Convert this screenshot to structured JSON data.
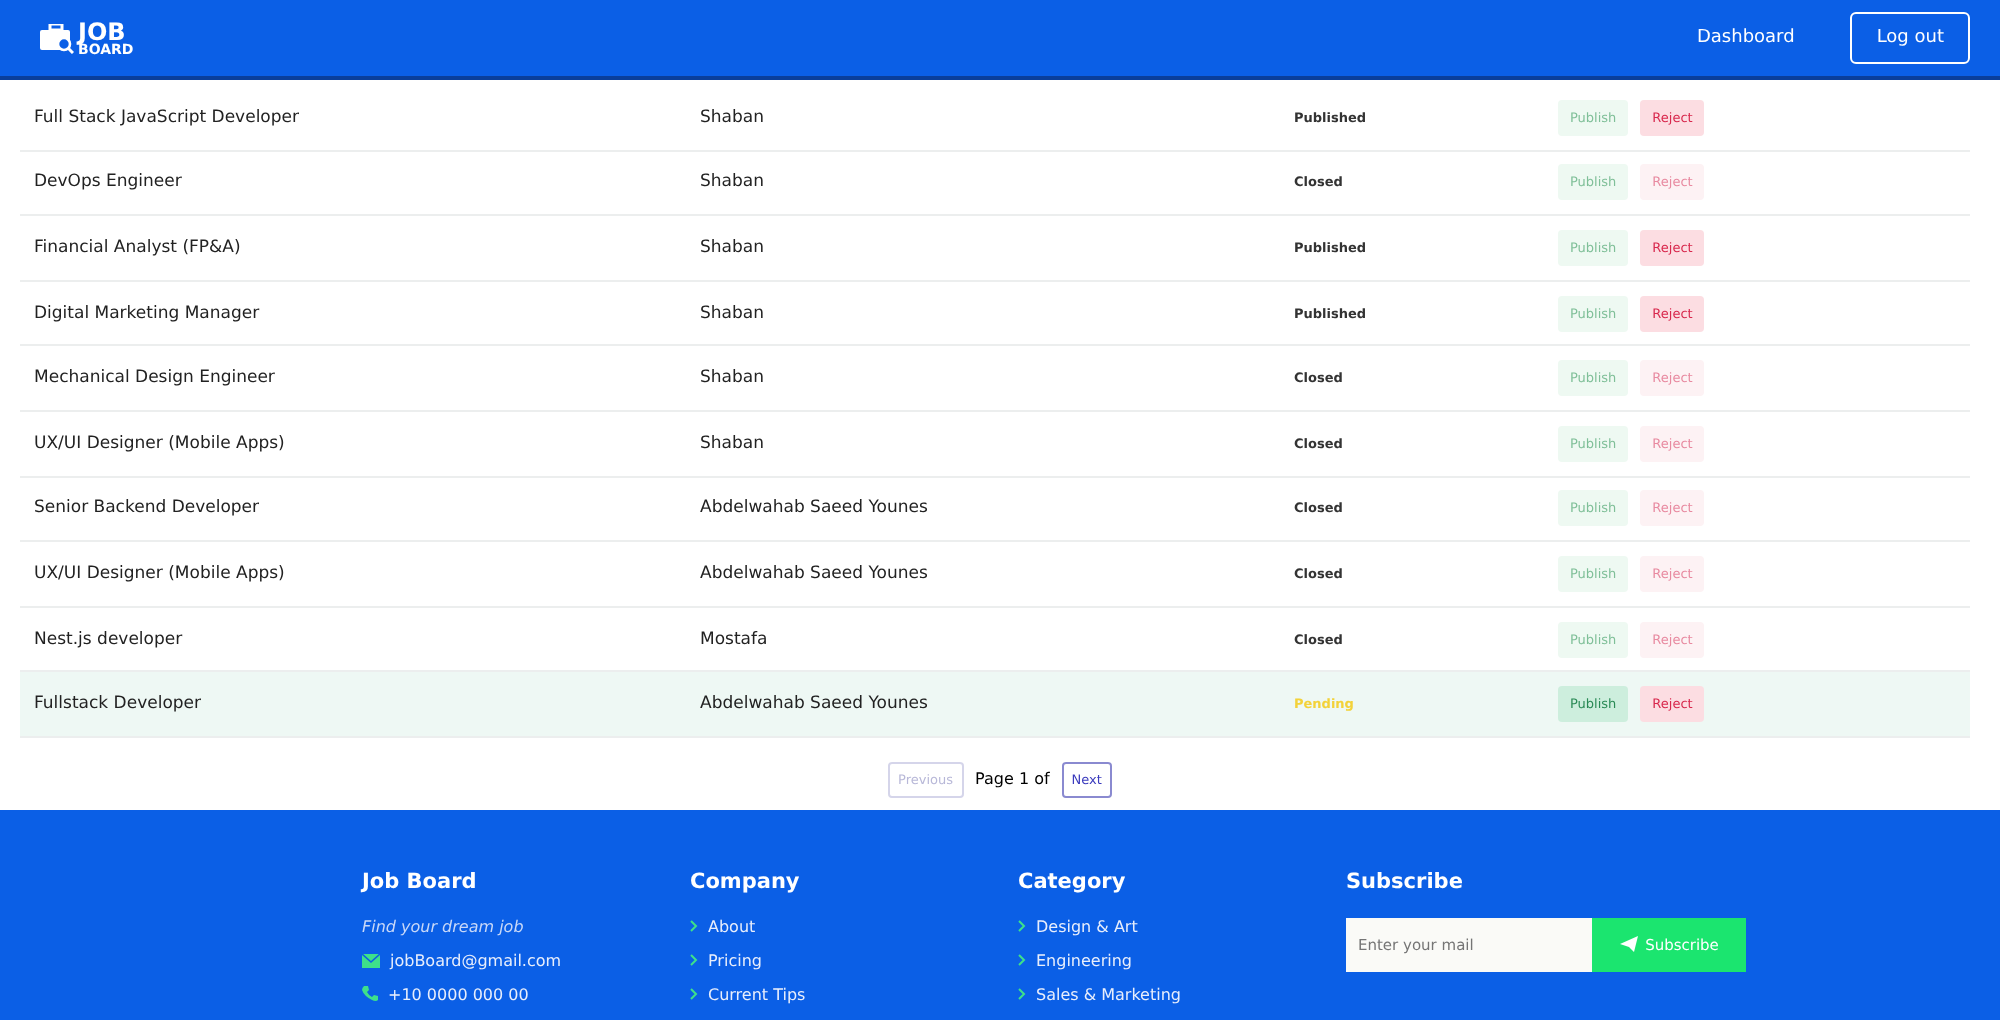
{
  "header": {
    "logo": {
      "line1": "JOB",
      "line2": "BOARD"
    },
    "nav": [
      {
        "label": "Dashboard",
        "kind": "link"
      },
      {
        "label": "Log out",
        "kind": "outlined"
      }
    ]
  },
  "jobs": [
    {
      "title": "Full Stack JavaScript Developer",
      "author": "Shaban",
      "status": "Published",
      "kind": "published",
      "publish": {
        "label": "Publish",
        "disabled": true
      },
      "reject": {
        "label": "Reject",
        "disabled": false
      },
      "highlighted": false
    },
    {
      "title": "DevOps Engineer",
      "author": "Shaban",
      "status": "Closed",
      "kind": "closed",
      "publish": {
        "label": "Publish",
        "disabled": true
      },
      "reject": {
        "label": "Reject",
        "disabled": true
      },
      "highlighted": false
    },
    {
      "title": "Financial Analyst (FP&A)",
      "author": "Shaban",
      "status": "Published",
      "kind": "published",
      "publish": {
        "label": "Publish",
        "disabled": true
      },
      "reject": {
        "label": "Reject",
        "disabled": false
      },
      "highlighted": false
    },
    {
      "title": "Digital Marketing Manager",
      "author": "Shaban",
      "status": "Published",
      "kind": "published",
      "publish": {
        "label": "Publish",
        "disabled": true
      },
      "reject": {
        "label": "Reject",
        "disabled": false
      },
      "highlighted": false
    },
    {
      "title": "Mechanical Design Engineer",
      "author": "Shaban",
      "status": "Closed",
      "kind": "closed",
      "publish": {
        "label": "Publish",
        "disabled": true
      },
      "reject": {
        "label": "Reject",
        "disabled": true
      },
      "highlighted": false
    },
    {
      "title": "UX/UI Designer (Mobile Apps)",
      "author": "Shaban",
      "status": "Closed",
      "kind": "closed",
      "publish": {
        "label": "Publish",
        "disabled": true
      },
      "reject": {
        "label": "Reject",
        "disabled": true
      },
      "highlighted": false
    },
    {
      "title": "Senior Backend Developer",
      "author": "Abdelwahab Saeed Younes",
      "status": "Closed",
      "kind": "closed",
      "publish": {
        "label": "Publish",
        "disabled": true
      },
      "reject": {
        "label": "Reject",
        "disabled": true
      },
      "highlighted": false
    },
    {
      "title": "UX/UI Designer (Mobile Apps)",
      "author": "Abdelwahab Saeed Younes",
      "status": "Closed",
      "kind": "closed",
      "publish": {
        "label": "Publish",
        "disabled": true
      },
      "reject": {
        "label": "Reject",
        "disabled": true
      },
      "highlighted": false
    },
    {
      "title": "Nest.js developer",
      "author": "Mostafa",
      "status": "Closed",
      "kind": "closed",
      "publish": {
        "label": "Publish",
        "disabled": true
      },
      "reject": {
        "label": "Reject",
        "disabled": true
      },
      "highlighted": false
    },
    {
      "title": "Fullstack Developer",
      "author": "Abdelwahab Saeed Younes",
      "status": "Pending",
      "kind": "pending",
      "publish": {
        "label": "Publish",
        "disabled": false
      },
      "reject": {
        "label": "Reject",
        "disabled": false
      },
      "highlighted": true
    }
  ],
  "pagination": {
    "previous": {
      "label": "Previous",
      "disabled": true
    },
    "page_text": "Page 1 of",
    "next": {
      "label": "Next",
      "disabled": false
    }
  },
  "footer": {
    "about": {
      "heading": "Job Board",
      "tagline": "Find your dream job",
      "email": "jobBoard@gmail.com",
      "phone": "+10 0000 000 00"
    },
    "company": {
      "heading": "Company",
      "links": [
        "About",
        "Pricing",
        "Current Tips"
      ]
    },
    "category": {
      "heading": "Category",
      "links": [
        "Design & Art",
        "Engineering",
        "Sales & Marketing"
      ]
    },
    "subscribe": {
      "heading": "Subscribe",
      "placeholder": "Enter your mail",
      "button": "Subscribe"
    }
  }
}
